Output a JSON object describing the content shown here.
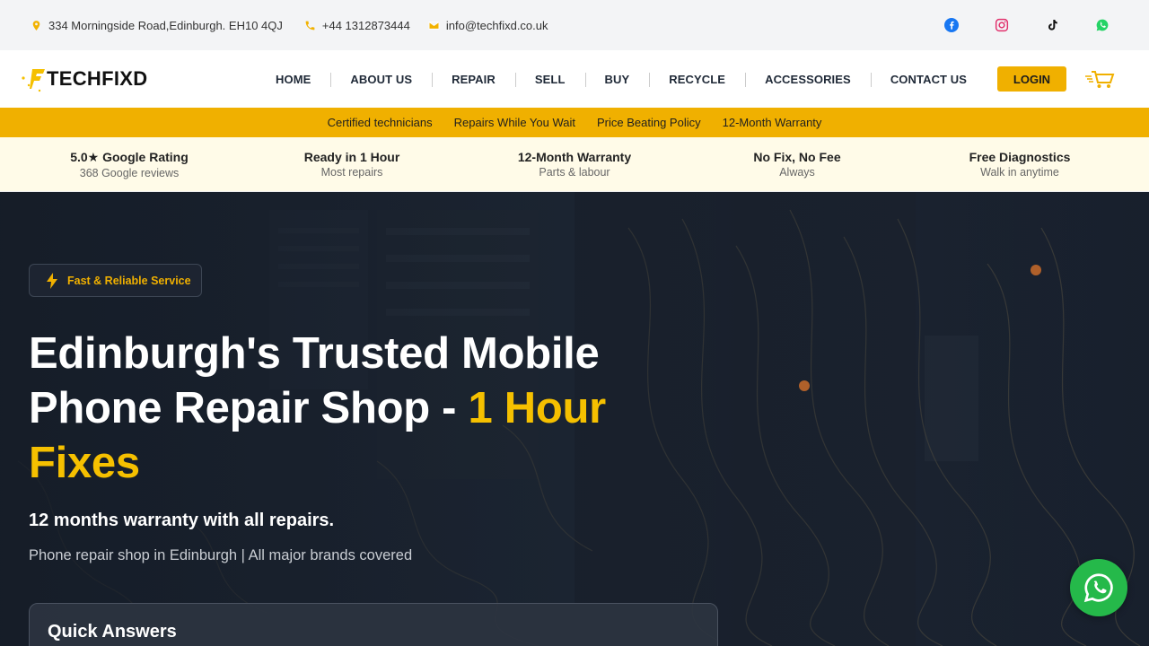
{
  "topbar": {
    "address": "334 Morningside Road,Edinburgh. EH10 4QJ",
    "phone": "+44 1312873444",
    "email": "info@techfixd.co.uk",
    "socials": [
      "facebook-icon",
      "instagram-icon",
      "tiktok-icon",
      "whatsapp-icon"
    ]
  },
  "brand": {
    "name": "TECHFIXD",
    "accent": "#f0b000"
  },
  "nav": {
    "items": [
      "HOME",
      "ABOUT US",
      "REPAIR",
      "SELL",
      "BUY",
      "RECYCLE",
      "ACCESSORIES",
      "CONTACT US"
    ],
    "login_label": "LOGIN"
  },
  "strip": {
    "items": [
      "Certified technicians",
      "Repairs While You Wait",
      "Price Beating Policy",
      "12-Month Warranty"
    ]
  },
  "trust": [
    {
      "title": "5.0★ Google Rating",
      "sub": "368 Google reviews"
    },
    {
      "title": "Ready in 1 Hour",
      "sub": "Most repairs"
    },
    {
      "title": "12-Month Warranty",
      "sub": "Parts & labour"
    },
    {
      "title": "No Fix, No Fee",
      "sub": "Always"
    },
    {
      "title": "Free Diagnostics",
      "sub": "Walk in anytime"
    }
  ],
  "hero": {
    "badge": "Fast & Reliable Service",
    "title_line1": "Edinburgh's Trusted Mobile",
    "title_line2_pre": "Phone Repair Shop - ",
    "title_line2_hl": "1 Hour",
    "title_line3_hl": "Fixes",
    "subtitle": "12 months warranty with all repairs.",
    "tagline": "Phone repair shop in Edinburgh | All major brands covered",
    "quick_title": "Quick Answers"
  }
}
